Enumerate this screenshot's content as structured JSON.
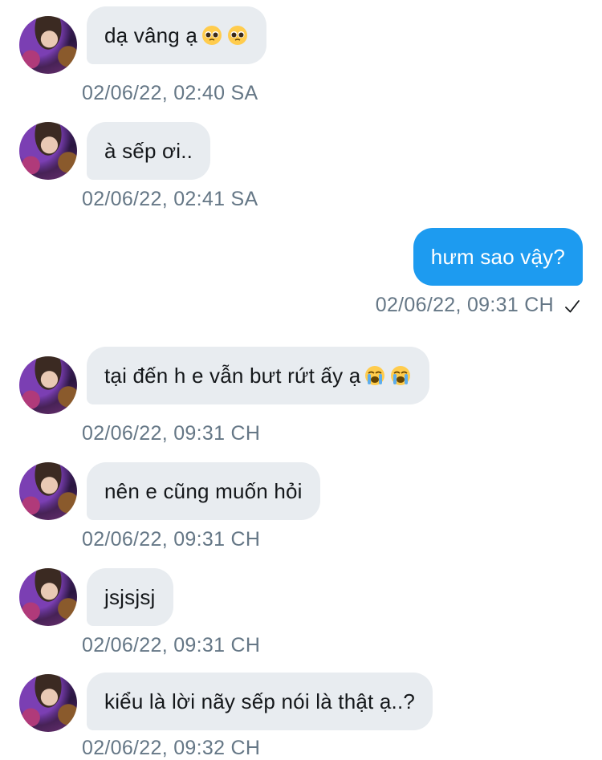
{
  "messages": [
    {
      "text": "dạ vâng ạ",
      "emoji": [
        "pleading-face",
        "pleading-face"
      ],
      "time": "02/06/22, 02:40 SA"
    },
    {
      "text": "à sếp ơi..",
      "time": "02/06/22, 02:41 SA"
    },
    {
      "text": "hưm sao vậy?",
      "time": "02/06/22, 09:31 CH",
      "status": "✓"
    },
    {
      "text": "tại đến h e vẫn bưt rứt ấy ạ",
      "emoji": [
        "loudly-crying-face",
        "loudly-crying-face"
      ],
      "time": "02/06/22, 09:31 CH"
    },
    {
      "text": "nên e cũng muốn hỏi",
      "time": "02/06/22, 09:31 CH"
    },
    {
      "text": "jsjsjsj",
      "time": "02/06/22, 09:31 CH"
    },
    {
      "text": "kiểu là lời nãy sếp nói là thật ạ..?",
      "time": "02/06/22, 09:32 CH"
    }
  ],
  "colors": {
    "incoming_bubble": "#e8ecf0",
    "outgoing_bubble": "#1d9bf0",
    "timestamp": "#657786",
    "text": "#14171a"
  }
}
